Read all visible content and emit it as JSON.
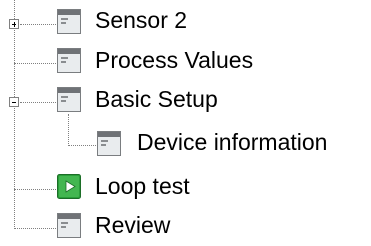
{
  "tree": {
    "nodes": [
      {
        "label": "Sensor 2",
        "icon": "page-icon",
        "expander": "expand-plus-icon"
      },
      {
        "label": "Process Values",
        "icon": "page-icon"
      },
      {
        "label": "Basic Setup",
        "icon": "page-icon",
        "expander": "collapse-minus-icon"
      },
      {
        "label": "Device information",
        "icon": "page-icon"
      },
      {
        "label": "Loop test",
        "icon": "play-icon"
      },
      {
        "label": "Review",
        "icon": "page-icon"
      }
    ]
  },
  "colors": {
    "page_icon_fill": "#e9ecee",
    "page_icon_header": "#6f7276",
    "play_icon_green": "#2a9d3a"
  }
}
